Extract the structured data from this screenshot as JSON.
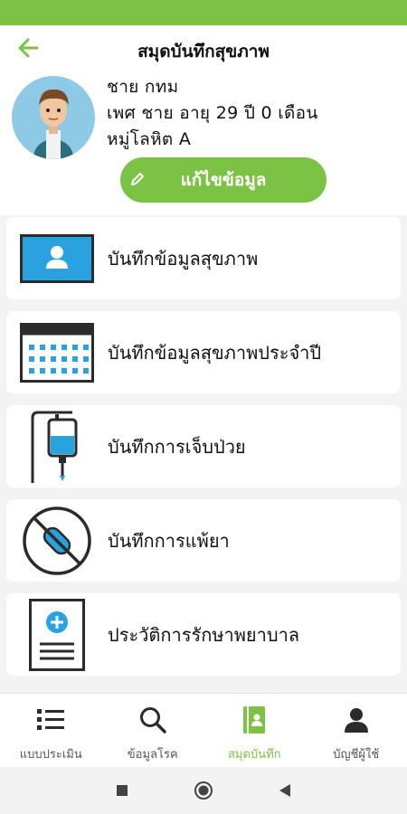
{
  "header": {
    "title": "สมุดบันทึกสุขภาพ",
    "name": "ชาย กทม",
    "info": "เพศ ชาย อายุ 29 ปี 0 เดือน",
    "blood": "หมู่โลหิต A",
    "edit_label": "แก้ไขข้อมูล"
  },
  "menu": [
    {
      "label": "บันทึกข้อมูลสุขภาพ",
      "icon": "id-card-icon"
    },
    {
      "label": "บันทึกข้อมูลสุขภาพประจำปี",
      "icon": "calendar-icon"
    },
    {
      "label": "บันทึกการเจ็บป่วย",
      "icon": "iv-drip-icon"
    },
    {
      "label": "บันทึกการแพ้ยา",
      "icon": "no-pill-icon"
    },
    {
      "label": "ประวัติการรักษาพยาบาล",
      "icon": "medical-document-icon"
    }
  ],
  "bottom_nav": [
    {
      "label": "แบบประเมิน",
      "icon": "list-icon"
    },
    {
      "label": "ข้อมูลโรค",
      "icon": "search-icon"
    },
    {
      "label": "สมุดบันทึก",
      "icon": "notebook-icon",
      "active": true
    },
    {
      "label": "บัญชีผู้ใช้",
      "icon": "user-icon"
    }
  ],
  "colors": {
    "accent": "#7cc245",
    "icon_blue": "#2aa2e0",
    "icon_dark": "#2b2b2b"
  }
}
